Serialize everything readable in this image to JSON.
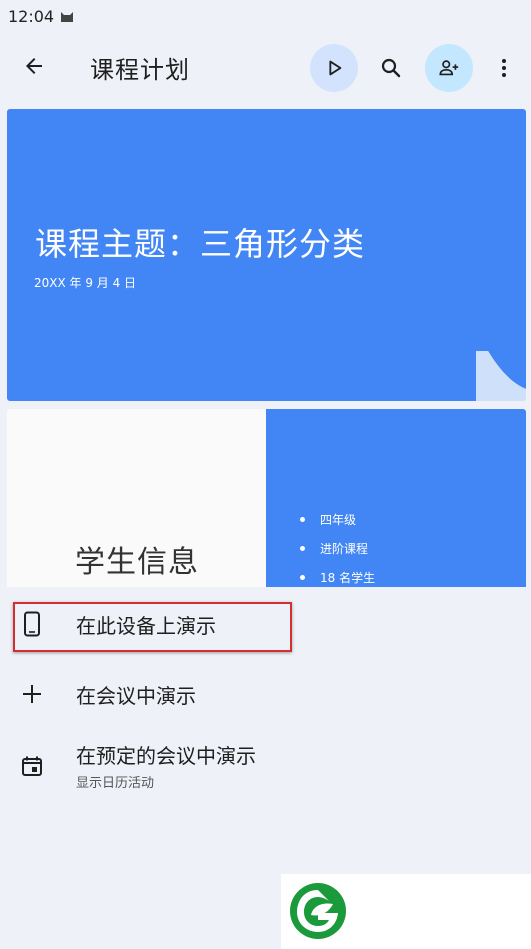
{
  "status_bar": {
    "time": "12:04",
    "icons": [
      "cat-icon"
    ]
  },
  "app_bar": {
    "title": "课程计划",
    "buttons": [
      "back-arrow-icon",
      "play-icon",
      "search-icon",
      "add-person-icon",
      "more-vert-icon"
    ]
  },
  "slide1": {
    "title": "课程主题：三角形分类",
    "date": "20XX 年 9 月 4 日",
    "color": "#4285f4"
  },
  "slide2": {
    "title": "学生信息",
    "bullets": [
      "四年级",
      "进阶课程",
      "18 名学生"
    ]
  },
  "menu": {
    "items": [
      {
        "label": "在此设备上演示",
        "icon": "phone-icon",
        "highlighted": true
      },
      {
        "label": "在会议中演示",
        "icon": "plus-icon"
      },
      {
        "label": "在预定的会议中演示",
        "sublabel": "显示日历活动",
        "icon": "calendar-icon"
      }
    ]
  },
  "colors": {
    "accent": "#4285f4",
    "highlight_border": "#d32f2f",
    "logo_green": "#1a9a3a"
  }
}
